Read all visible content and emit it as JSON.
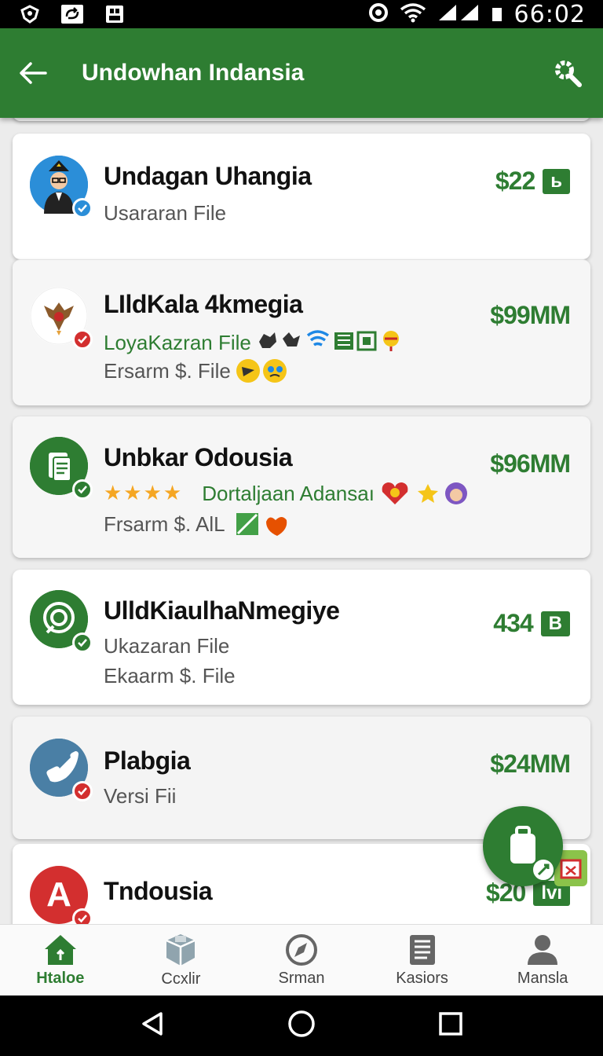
{
  "status_bar": {
    "time": "66:02"
  },
  "app_bar": {
    "title": "Undowhan Indansia"
  },
  "items": [
    {
      "title": "Undagan Uhangia",
      "line1": "Usararan File",
      "price": "$22",
      "tag": "ь"
    },
    {
      "title": "LIldKala 4kmegia",
      "line1": "LoyaKazran File",
      "line2": "Ersarm $. File",
      "price": "$99MM"
    },
    {
      "title": "Unbkar Odousia",
      "line1": "Dortaljaan Adansaı",
      "line2": "Frsarm $. AlL",
      "price": "$96MM",
      "rating": 4
    },
    {
      "title": "UlldKiaulhaNmegiye",
      "line1": "Ukazaran File",
      "line2": "Ekaarm $. File",
      "price": "434",
      "tag": "В"
    },
    {
      "title": "Plabgia",
      "line1": "Versi Fii",
      "price": "$24MM"
    },
    {
      "title": "Tndousia",
      "price": "$20",
      "tag": "lvı"
    }
  ],
  "avatar_letter": "A",
  "bottom_nav": [
    {
      "label": "Htaloe",
      "icon": "home-icon"
    },
    {
      "label": "Ccxlir",
      "icon": "box-icon"
    },
    {
      "label": "Srman",
      "icon": "compass-icon"
    },
    {
      "label": "Kasiors",
      "icon": "document-icon"
    },
    {
      "label": "Mansla",
      "icon": "person-icon"
    }
  ],
  "colors": {
    "primary": "#2e7d32",
    "accent_red": "#d32f2f",
    "star": "#f5a623"
  }
}
